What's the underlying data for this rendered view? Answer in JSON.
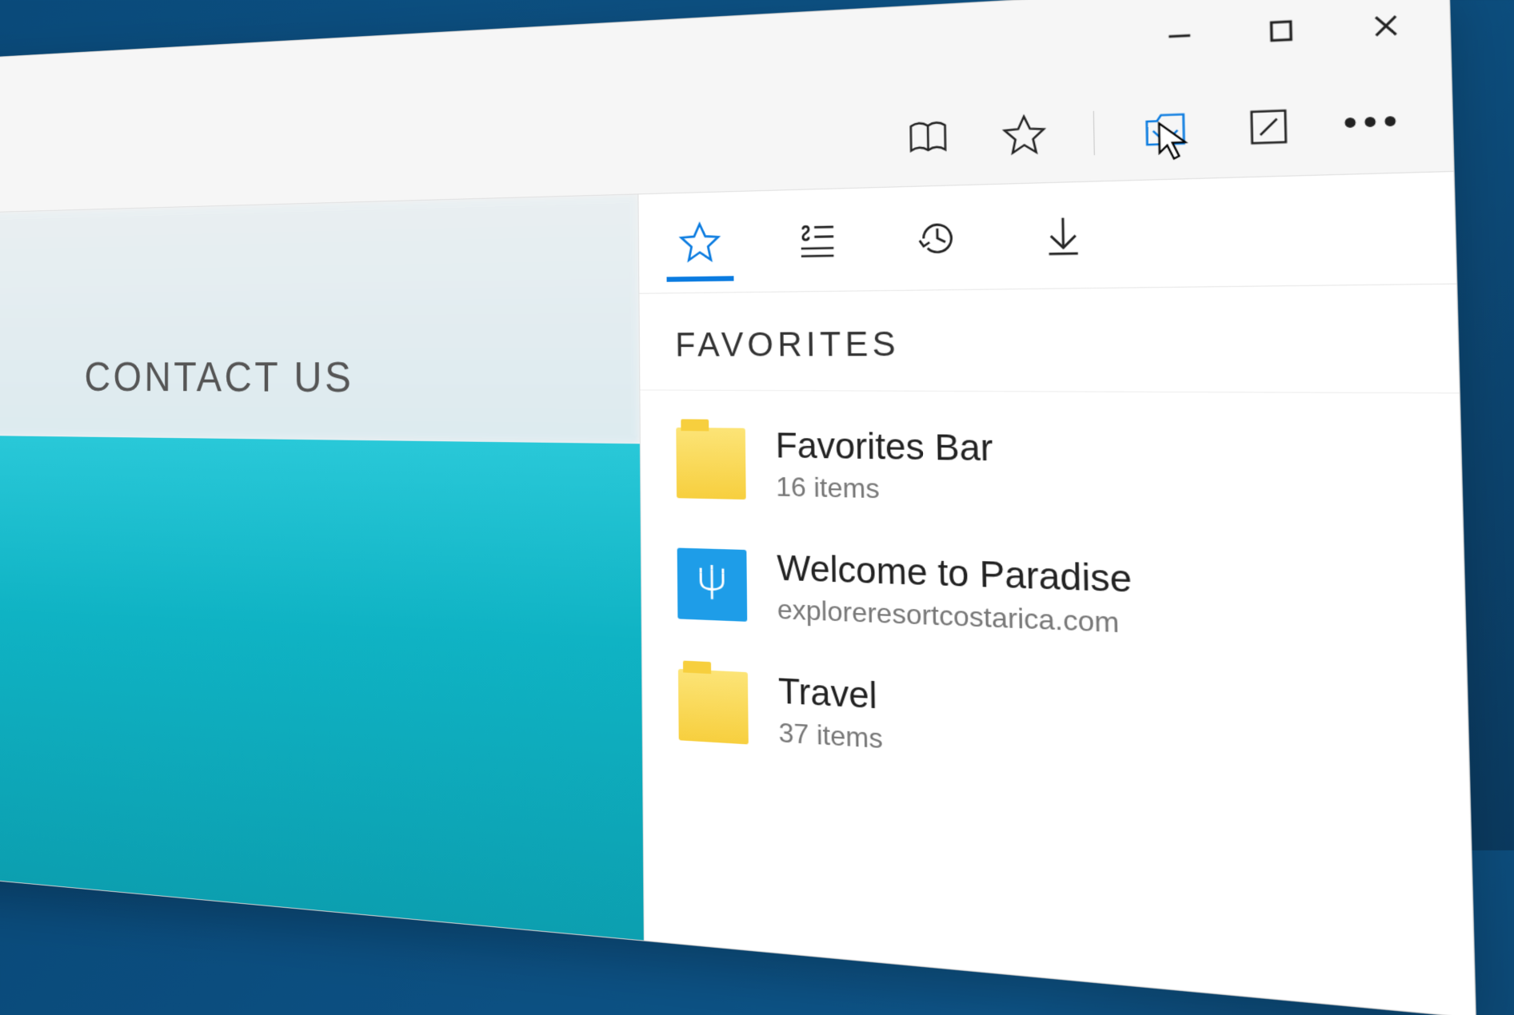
{
  "window_controls": {
    "minimize_label": "Minimize",
    "maximize_label": "Maximize",
    "close_label": "Close"
  },
  "toolbar": {
    "reading_view_label": "Reading view",
    "favorite_label": "Add to favorites",
    "hub_label": "Hub",
    "webnote_label": "Make a Web Note",
    "more_label": "More"
  },
  "page": {
    "contact_heading": "CONTACT US"
  },
  "hub": {
    "tabs": {
      "favorites_label": "Favorites",
      "reading_list_label": "Reading list",
      "history_label": "History",
      "downloads_label": "Downloads"
    },
    "panel_title": "FAVORITES",
    "items": [
      {
        "kind": "folder",
        "title": "Favorites Bar",
        "subtitle": "16 items"
      },
      {
        "kind": "site",
        "title": "Welcome to Paradise",
        "subtitle": "exploreresortcostarica.com"
      },
      {
        "kind": "folder",
        "title": "Travel",
        "subtitle": "37 items"
      }
    ]
  },
  "colors": {
    "accent": "#0a7be0",
    "folder": "#f7cf3e",
    "site": "#1e9de8"
  }
}
